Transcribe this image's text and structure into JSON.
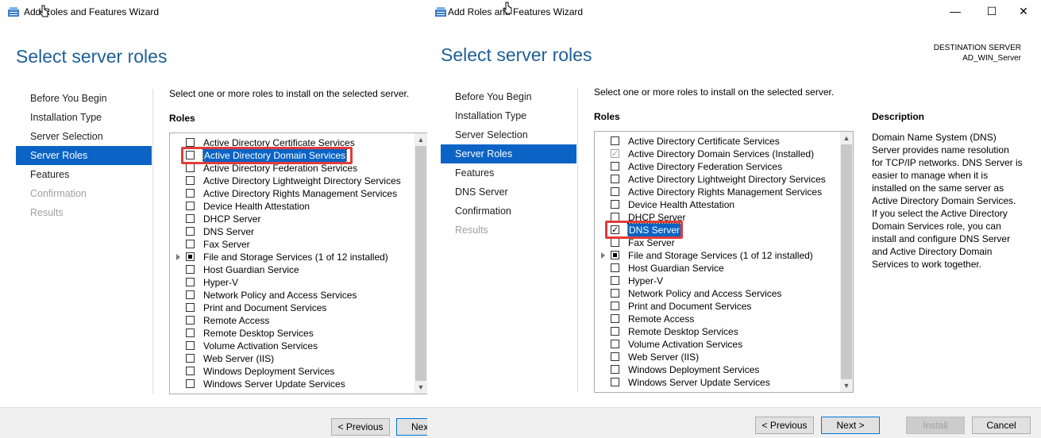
{
  "left": {
    "title": "Add Roles and Features Wizard",
    "heading": "Select server roles",
    "instruction": "Select one or more roles to install on the selected server.",
    "roles_label": "Roles",
    "nav": [
      {
        "label": "Before You Begin",
        "state": "normal"
      },
      {
        "label": "Installation Type",
        "state": "normal"
      },
      {
        "label": "Server Selection",
        "state": "normal"
      },
      {
        "label": "Server Roles",
        "state": "active"
      },
      {
        "label": "Features",
        "state": "normal"
      },
      {
        "label": "Confirmation",
        "state": "disabled"
      },
      {
        "label": "Results",
        "state": "disabled"
      }
    ],
    "roles": [
      {
        "label": "Active Directory Certificate Services",
        "check": "none"
      },
      {
        "label": "Active Directory Domain Services",
        "check": "none",
        "selected": true
      },
      {
        "label": "Active Directory Federation Services",
        "check": "none"
      },
      {
        "label": "Active Directory Lightweight Directory Services",
        "check": "none"
      },
      {
        "label": "Active Directory Rights Management Services",
        "check": "none"
      },
      {
        "label": "Device Health Attestation",
        "check": "none"
      },
      {
        "label": "DHCP Server",
        "check": "none"
      },
      {
        "label": "DNS Server",
        "check": "none"
      },
      {
        "label": "Fax Server",
        "check": "none"
      },
      {
        "label": "File and Storage Services (1 of 12 installed)",
        "check": "partial",
        "expandable": true
      },
      {
        "label": "Host Guardian Service",
        "check": "none"
      },
      {
        "label": "Hyper-V",
        "check": "none"
      },
      {
        "label": "Network Policy and Access Services",
        "check": "none"
      },
      {
        "label": "Print and Document Services",
        "check": "none"
      },
      {
        "label": "Remote Access",
        "check": "none"
      },
      {
        "label": "Remote Desktop Services",
        "check": "none"
      },
      {
        "label": "Volume Activation Services",
        "check": "none"
      },
      {
        "label": "Web Server (IIS)",
        "check": "none"
      },
      {
        "label": "Windows Deployment Services",
        "check": "none"
      },
      {
        "label": "Windows Server Update Services",
        "check": "none"
      }
    ],
    "buttons": {
      "previous": "< Previous",
      "next": "Nex"
    }
  },
  "right": {
    "title": "Add Roles and Features Wizard",
    "heading": "Select server roles",
    "destination_label": "DESTINATION SERVER",
    "destination_server": "AD_WIN_Server",
    "instruction": "Select one or more roles to install on the selected server.",
    "roles_label": "Roles",
    "description_label": "Description",
    "description_text": "Domain Name System (DNS) Server provides name resolution for TCP/IP networks. DNS Server is easier to manage when it is installed on the same server as Active Directory Domain Services. If you select the Active Directory Domain Services role, you can install and configure DNS Server and Active Directory Domain Services to work together.",
    "nav": [
      {
        "label": "Before You Begin",
        "state": "normal"
      },
      {
        "label": "Installation Type",
        "state": "normal"
      },
      {
        "label": "Server Selection",
        "state": "normal"
      },
      {
        "label": "Server Roles",
        "state": "active"
      },
      {
        "label": "Features",
        "state": "normal"
      },
      {
        "label": "DNS Server",
        "state": "normal"
      },
      {
        "label": "Confirmation",
        "state": "normal"
      },
      {
        "label": "Results",
        "state": "disabled"
      }
    ],
    "roles": [
      {
        "label": "Active Directory Certificate Services",
        "check": "none"
      },
      {
        "label": "Active Directory Domain Services (Installed)",
        "check": "grey"
      },
      {
        "label": "Active Directory Federation Services",
        "check": "none"
      },
      {
        "label": "Active Directory Lightweight Directory Services",
        "check": "none"
      },
      {
        "label": "Active Directory Rights Management Services",
        "check": "none"
      },
      {
        "label": "Device Health Attestation",
        "check": "none"
      },
      {
        "label": "DHCP Server",
        "check": "none"
      },
      {
        "label": "DNS Server",
        "check": "checked",
        "selected": true
      },
      {
        "label": "Fax Server",
        "check": "none"
      },
      {
        "label": "File and Storage Services (1 of 12 installed)",
        "check": "partial",
        "expandable": true
      },
      {
        "label": "Host Guardian Service",
        "check": "none"
      },
      {
        "label": "Hyper-V",
        "check": "none"
      },
      {
        "label": "Network Policy and Access Services",
        "check": "none"
      },
      {
        "label": "Print and Document Services",
        "check": "none"
      },
      {
        "label": "Remote Access",
        "check": "none"
      },
      {
        "label": "Remote Desktop Services",
        "check": "none"
      },
      {
        "label": "Volume Activation Services",
        "check": "none"
      },
      {
        "label": "Web Server (IIS)",
        "check": "none"
      },
      {
        "label": "Windows Deployment Services",
        "check": "none"
      },
      {
        "label": "Windows Server Update Services",
        "check": "none"
      }
    ],
    "buttons": {
      "previous": "< Previous",
      "next": "Next >",
      "install": "Install",
      "cancel": "Cancel"
    },
    "window_controls": {
      "minimize": "—",
      "maximize": "☐",
      "close": "✕"
    }
  },
  "colors": {
    "accent": "#0b63c5",
    "heading": "#1f5f96",
    "highlight": "#e03c3c"
  }
}
